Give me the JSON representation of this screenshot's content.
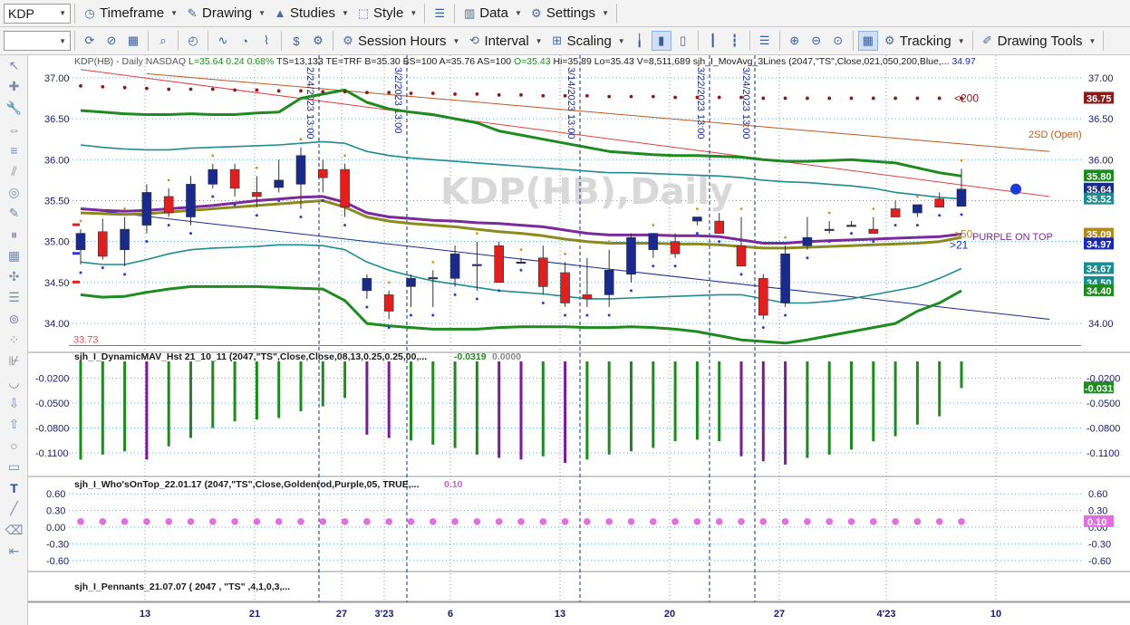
{
  "toolbar1": {
    "symbol": "KDP",
    "items": [
      {
        "label": "Timeframe",
        "icon": "clock-icon"
      },
      {
        "label": "Drawing",
        "icon": "pencil-icon"
      },
      {
        "label": "Studies",
        "icon": "studies-icon"
      },
      {
        "label": "Style",
        "icon": "style-icon"
      },
      {
        "label": "Data",
        "icon": "data-icon"
      },
      {
        "label": "Settings",
        "icon": "gear-icon"
      }
    ]
  },
  "toolbar2": {
    "items": [
      {
        "label": "Session Hours",
        "icon": "session-icon"
      },
      {
        "label": "Interval",
        "icon": "interval-icon"
      },
      {
        "label": "Scaling",
        "icon": "scaling-icon"
      },
      {
        "label": "Tracking",
        "icon": "tracking-icon"
      },
      {
        "label": "Drawing Tools",
        "icon": "drawing-tools-icon"
      }
    ]
  },
  "left_tools": [
    "arrow-pointer-icon",
    "crosshair-icon",
    "wrench-icon",
    "move-icon",
    "lines-icon",
    "parallel-lines-icon",
    "circle-target-icon",
    "pencil-draw-icon",
    "vertical-bars-icon",
    "grid-icon",
    "tools-icon",
    "list-icon",
    "fibonacci-icon",
    "dotted-triangle-icon",
    "cancel-bars-icon",
    "arc-icon",
    "arrow-down-icon",
    "arrow-up-icon",
    "circle-icon",
    "rectangle-icon",
    "text-tool-icon",
    "dashed-icon",
    "eraser-icon",
    "collapse-icon"
  ],
  "chart": {
    "watermark": "KDP(HB),Daily",
    "header": {
      "symbol": "KDP(HB) - Daily  NASDAQ",
      "last": "L=35.64",
      "chg": "0.24",
      "pct": "0.68%",
      "rest": "TS=13,133  TE=TRF  B=35.30  BS=100  A=35.76  AS=100",
      "open": "O=35.43",
      "hilo": "Hi=35.89  Lo=35.43  V=8,511,689",
      "study": "sjh_I_MovAvg_3Lines (2047,\"TS\",Close,021,050,200,Blue,...",
      "study_val": "34.97"
    },
    "price_axis": {
      "min": 33.68,
      "max": 37.12,
      "ticks": [
        "37.00",
        "36.50",
        "36.00",
        "35.50",
        "35.00",
        "34.50",
        "34.00"
      ]
    },
    "price_tags": [
      {
        "text": "36.75",
        "value": 36.75,
        "color": "#8b1a1a"
      },
      {
        "text": "35.80",
        "value": 35.8,
        "color": "#1f8a1f"
      },
      {
        "text": "35.64",
        "value": 35.64,
        "color": "#1a2a8a"
      },
      {
        "text": "35.52",
        "value": 35.52,
        "color": "#1e8c8c"
      },
      {
        "text": "35.09",
        "value": 35.09,
        "color": "#b08a1a"
      },
      {
        "text": "34.97",
        "value": 34.97,
        "color": "#1a2ab0"
      },
      {
        "text": "34.67",
        "value": 34.67,
        "color": "#1e8c8c"
      },
      {
        "text": "34.50",
        "value": 34.5,
        "color": "#1e8c8c"
      },
      {
        "text": "34.40",
        "value": 34.4,
        "color": "#1f8a1f"
      }
    ],
    "labels": {
      "l200": "<200",
      "sd2": "2SD (Open)",
      "l50": ">50",
      "l21": ">21",
      "purple": "PURPLE ON TOP",
      "low_ref": "33.73"
    },
    "vlines": [
      "2/24/2023 13:00",
      "3/2/2023 13:00",
      "3/14/2023 13:00",
      "3/22/2023 13:00",
      "3/24/2023 13:00"
    ],
    "date_axis": [
      "13",
      "21",
      "27",
      "3'23",
      "6",
      "13",
      "20",
      "27",
      "4'23",
      "10"
    ]
  },
  "chart_data": [
    {
      "type": "candlestick",
      "title": "KDP(HB),Daily",
      "candles": [
        [
          34.9,
          35.15,
          34.72,
          35.1
        ],
        [
          35.12,
          35.28,
          34.78,
          34.82
        ],
        [
          34.9,
          35.3,
          34.7,
          35.15
        ],
        [
          35.2,
          35.7,
          35.1,
          35.6
        ],
        [
          35.55,
          35.65,
          35.3,
          35.35
        ],
        [
          35.3,
          35.8,
          35.2,
          35.7
        ],
        [
          35.7,
          35.95,
          35.65,
          35.88
        ],
        [
          35.88,
          35.95,
          35.55,
          35.65
        ],
        [
          35.6,
          35.8,
          35.42,
          35.55
        ],
        [
          35.66,
          36.0,
          35.6,
          35.75
        ],
        [
          35.7,
          36.15,
          35.4,
          36.05
        ],
        [
          35.88,
          36.0,
          35.6,
          35.78
        ],
        [
          35.88,
          35.95,
          35.3,
          35.42
        ],
        [
          34.4,
          34.6,
          34.3,
          34.55
        ],
        [
          34.35,
          34.4,
          34.05,
          34.15
        ],
        [
          34.45,
          34.6,
          34.2,
          34.55
        ],
        [
          34.55,
          34.65,
          34.2,
          34.56
        ],
        [
          34.55,
          34.95,
          34.45,
          34.85
        ],
        [
          34.71,
          35.0,
          34.4,
          34.72
        ],
        [
          34.95,
          35.0,
          34.5,
          34.5
        ],
        [
          34.75,
          34.8,
          34.75,
          34.75
        ],
        [
          34.8,
          34.95,
          34.35,
          34.45
        ],
        [
          34.62,
          34.75,
          34.2,
          34.25
        ],
        [
          34.35,
          34.8,
          34.2,
          34.3
        ],
        [
          34.35,
          34.9,
          34.2,
          34.65
        ],
        [
          34.6,
          35.1,
          34.5,
          35.05
        ],
        [
          34.9,
          35.1,
          34.8,
          35.1
        ],
        [
          35.0,
          35.1,
          34.8,
          34.85
        ],
        [
          35.25,
          35.3,
          35.2,
          35.3
        ],
        [
          35.25,
          35.35,
          35.1,
          35.1
        ],
        [
          34.95,
          35.3,
          34.7,
          34.7
        ],
        [
          34.55,
          34.6,
          34.05,
          34.1
        ],
        [
          34.25,
          34.95,
          34.2,
          34.85
        ],
        [
          34.95,
          35.3,
          34.9,
          35.05
        ],
        [
          35.15,
          35.25,
          35.1,
          35.15
        ],
        [
          35.2,
          35.25,
          35.2,
          35.2
        ],
        [
          35.15,
          35.3,
          35.1,
          35.1
        ],
        [
          35.4,
          35.5,
          35.3,
          35.3
        ],
        [
          35.35,
          35.45,
          35.3,
          35.45
        ],
        [
          35.52,
          35.6,
          35.42,
          35.42
        ],
        [
          35.43,
          35.89,
          35.43,
          35.64
        ]
      ],
      "ma21": [
        35.4,
        35.38,
        35.37,
        35.38,
        35.4,
        35.42,
        35.44,
        35.47,
        35.5,
        35.52,
        35.54,
        35.55,
        35.48,
        35.35,
        35.3,
        35.28,
        35.26,
        35.25,
        35.23,
        35.22,
        35.2,
        35.18,
        35.14,
        35.1,
        35.08,
        35.08,
        35.08,
        35.07,
        35.07,
        35.06,
        35.02,
        34.98,
        34.98,
        35.0,
        35.01,
        35.02,
        35.03,
        35.04,
        35.05,
        35.06,
        35.09
      ],
      "ma50": [
        35.35,
        35.34,
        35.33,
        35.34,
        35.36,
        35.38,
        35.4,
        35.42,
        35.44,
        35.46,
        35.48,
        35.5,
        35.42,
        35.3,
        35.25,
        35.22,
        35.2,
        35.18,
        35.15,
        35.12,
        35.1,
        35.07,
        35.03,
        35.0,
        34.98,
        34.98,
        34.98,
        34.97,
        34.97,
        34.96,
        34.94,
        34.92,
        34.92,
        34.93,
        34.94,
        34.95,
        34.96,
        34.97,
        34.98,
        35.0,
        35.05
      ],
      "ma200": [
        36.9,
        36.89,
        36.88,
        36.87,
        36.86,
        36.86,
        36.86,
        36.85,
        36.85,
        36.84,
        36.84,
        36.83,
        36.83,
        36.82,
        36.82,
        36.81,
        36.81,
        36.8,
        36.8,
        36.79,
        36.79,
        36.78,
        36.78,
        36.78,
        36.77,
        36.77,
        36.77,
        36.76,
        36.76,
        36.76,
        36.76,
        36.75,
        36.75,
        36.75,
        36.75,
        36.75,
        36.75,
        36.75,
        36.75,
        36.75,
        36.75
      ],
      "band_outer_upper": [
        36.6,
        36.58,
        36.56,
        36.55,
        36.55,
        36.56,
        36.55,
        36.55,
        36.57,
        36.58,
        36.75,
        36.8,
        36.85,
        36.7,
        36.62,
        36.58,
        36.55,
        36.5,
        36.45,
        36.35,
        36.3,
        36.25,
        36.2,
        36.15,
        36.1,
        36.08,
        36.06,
        36.05,
        36.05,
        36.04,
        36.03,
        36.0,
        35.98,
        35.98,
        35.99,
        36.0,
        35.98,
        35.96,
        35.9,
        35.84,
        35.8
      ],
      "band_inner_upper": [
        36.18,
        36.15,
        36.13,
        36.12,
        36.12,
        36.14,
        36.15,
        36.16,
        36.17,
        36.18,
        36.2,
        36.22,
        36.2,
        36.1,
        36.05,
        36.02,
        36.0,
        35.98,
        35.96,
        35.94,
        35.92,
        35.9,
        35.88,
        35.86,
        35.84,
        35.84,
        35.83,
        35.82,
        35.81,
        35.8,
        35.78,
        35.75,
        35.73,
        35.72,
        35.7,
        35.68,
        35.65,
        35.6,
        35.57,
        35.54,
        35.52
      ],
      "band_inner_lower": [
        34.75,
        34.72,
        34.72,
        34.78,
        34.85,
        34.9,
        34.92,
        34.93,
        34.94,
        34.96,
        34.96,
        34.95,
        34.9,
        34.75,
        34.65,
        34.58,
        34.52,
        34.48,
        34.44,
        34.4,
        34.38,
        34.36,
        34.33,
        34.3,
        34.3,
        34.31,
        34.32,
        34.33,
        34.34,
        34.35,
        34.35,
        34.3,
        34.25,
        34.25,
        34.27,
        34.3,
        34.35,
        34.4,
        34.45,
        34.55,
        34.67
      ],
      "band_outer_lower": [
        34.35,
        34.32,
        34.33,
        34.38,
        34.42,
        34.45,
        34.45,
        34.45,
        34.45,
        34.44,
        34.43,
        34.42,
        34.28,
        34.0,
        33.97,
        33.95,
        33.93,
        33.93,
        33.93,
        33.95,
        33.96,
        33.96,
        33.96,
        33.95,
        33.95,
        33.96,
        33.95,
        33.93,
        33.9,
        33.85,
        33.8,
        33.78,
        33.76,
        33.8,
        33.85,
        33.9,
        33.95,
        34.0,
        34.15,
        34.25,
        34.4
      ],
      "trendlines": [
        {
          "color": "#e04040",
          "from": [
            0,
            37.1
          ],
          "to": [
            44,
            35.55
          ]
        },
        {
          "color": "#1a2a8a",
          "from": [
            0,
            35.4
          ],
          "to": [
            44,
            34.05
          ]
        },
        {
          "color": "#b85a20",
          "from": [
            3,
            37.05
          ],
          "to": [
            44,
            36.1
          ]
        }
      ]
    },
    {
      "type": "bar",
      "title": "sjh_I_DynamicMAV_Hst 21_10_11 (2047,\"TS\",Close,Close,08,13,0.25,0.25,00,...",
      "last_value": "-0.0319",
      "secondary_value": "0.0000",
      "ticks": [
        "-0.0200",
        "-0.0500",
        "-0.0800",
        "-0.1100"
      ],
      "ylim": [
        -0.135,
        0.0
      ],
      "values": [
        -0.118,
        -0.112,
        -0.108,
        -0.118,
        -0.102,
        -0.092,
        -0.08,
        -0.072,
        -0.07,
        -0.068,
        -0.06,
        -0.054,
        -0.044,
        -0.088,
        -0.092,
        -0.095,
        -0.1,
        -0.104,
        -0.112,
        -0.116,
        -0.118,
        -0.114,
        -0.122,
        -0.118,
        -0.112,
        -0.108,
        -0.104,
        -0.096,
        -0.094,
        -0.096,
        -0.114,
        -0.12,
        -0.124,
        -0.116,
        -0.112,
        -0.106,
        -0.096,
        -0.09,
        -0.076,
        -0.066,
        -0.032
      ],
      "colors": [
        "g",
        "g",
        "g",
        "p",
        "g",
        "g",
        "g",
        "g",
        "g",
        "g",
        "g",
        "g",
        "g",
        "p",
        "p",
        "g",
        "g",
        "g",
        "g",
        "p",
        "p",
        "g",
        "p",
        "g",
        "g",
        "g",
        "g",
        "g",
        "g",
        "g",
        "p",
        "p",
        "p",
        "g",
        "g",
        "g",
        "g",
        "g",
        "g",
        "g",
        "g"
      ]
    },
    {
      "type": "scatter",
      "title": "sjh_I_Who'sOnTop_22.01.17 (2047,\"TS\",Close,Goldenrod,Purple,05, TRUE,...",
      "last_value": "0.10",
      "ticks": [
        "0.60",
        "0.30",
        "0.00",
        "-0.30",
        "-0.60"
      ],
      "ylim": [
        -0.75,
        0.75
      ],
      "value": 0.1
    },
    {
      "type": "table",
      "title": "sjh_I_Pennants_21.07.07 ( 2047 , \"TS\" ,4,1,0,3,..."
    }
  ]
}
